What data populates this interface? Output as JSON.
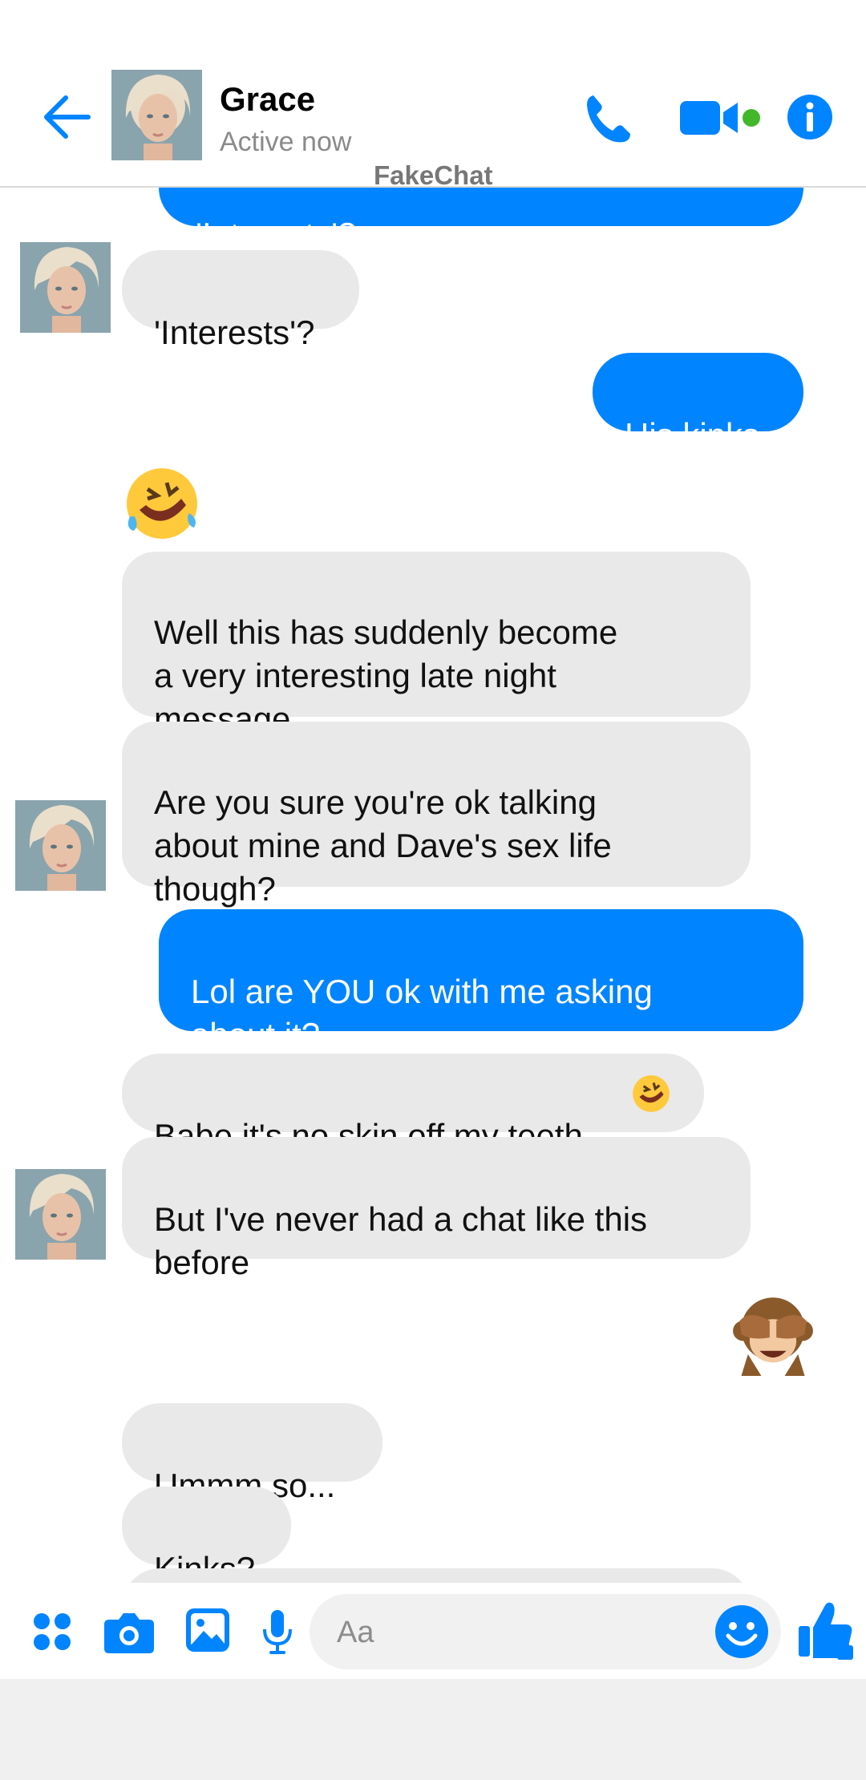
{
  "header": {
    "contact_name": "Grace",
    "status": "Active now",
    "watermark": "FakeChat",
    "online_color": "#42b72a",
    "accent_color": "#0084ff"
  },
  "messages": [
    {
      "from": "me",
      "text": "'Interests'?",
      "note": "partially scrolled off"
    },
    {
      "from": "contact",
      "text": "'Interests'?"
    },
    {
      "from": "me",
      "text": "His kinks"
    },
    {
      "from": "contact",
      "emoji": "rolling-on-floor-laughing"
    },
    {
      "from": "contact",
      "text": "Well this has suddenly become\na very interesting late night\nmessage"
    },
    {
      "from": "contact",
      "text": "Are you sure you're ok talking\nabout mine and Dave's sex life\nthough?"
    },
    {
      "from": "me",
      "text": "Lol are YOU ok with me asking\nabout it?"
    },
    {
      "from": "contact",
      "text": "Babe it's no skin off my teeth"
    },
    {
      "from": "contact",
      "text": "But I've never had a chat like this\nbefore"
    },
    {
      "from": "me",
      "emoji": "see-no-evil-monkey"
    },
    {
      "from": "contact",
      "text": "Ummm so..."
    },
    {
      "from": "contact",
      "text": "Kinks?"
    }
  ],
  "composer": {
    "placeholder": "Aa",
    "icons": [
      "apps-icon",
      "camera-icon",
      "gallery-icon",
      "microphone-icon",
      "emoji-icon",
      "thumbs-up-icon"
    ]
  }
}
